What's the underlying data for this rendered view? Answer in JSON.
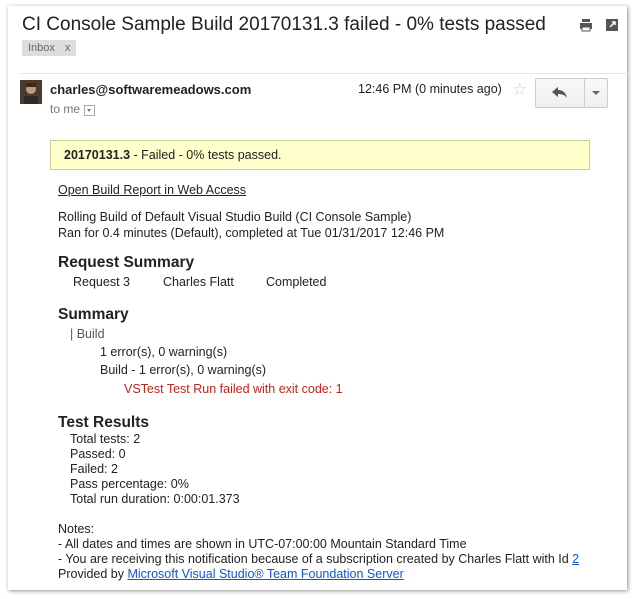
{
  "email": {
    "subject": "CI Console Sample Build 20170131.3 failed - 0% tests passed",
    "label": "Inbox",
    "label_remove": "x",
    "sender": "charles@softwaremeadows.com",
    "recipient": "to me",
    "time": "12:46 PM (0 minutes ago)"
  },
  "banner": {
    "build_number": "20170131.3",
    "status": " - Failed - 0% tests passed."
  },
  "body": {
    "report_link": "Open Build Report in Web Access",
    "line1": "Rolling Build of Default Visual Studio Build (CI Console Sample)",
    "line2": "Ran for 0.4 minutes (Default), completed at Tue 01/31/2017 12:46 PM",
    "request_summary": {
      "heading": "Request Summary",
      "request": "Request 3",
      "user": "Charles Flatt",
      "state": "Completed"
    },
    "summary": {
      "heading": "Summary",
      "build": "| Build",
      "errors": "1 error(s), 0 warning(s)",
      "build_detail": "Build - 1 error(s), 0 warning(s)",
      "error_message": "VSTest Test Run failed with exit code: 1"
    },
    "test_results": {
      "heading": "Test Results",
      "total": "Total tests: 2",
      "passed": "Passed: 0",
      "failed": "Failed: 2",
      "pass_pct": "Pass percentage: 0%",
      "duration": "Total run duration: 0:00:01.373"
    },
    "notes": {
      "heading": "Notes:",
      "note1": "- All dates and times are shown in UTC-07:00:00 Mountain Standard Time",
      "note2_prefix": "- You are receiving this notification because of a subscription created by Charles Flatt with Id ",
      "note2_id": "2",
      "provided_prefix": "Provided by ",
      "provided_link": "Microsoft Visual Studio® Team Foundation Server"
    }
  },
  "colors": {
    "banner_bg": "#ffffcc",
    "link": "#1155cc",
    "error": "#c0241e"
  }
}
